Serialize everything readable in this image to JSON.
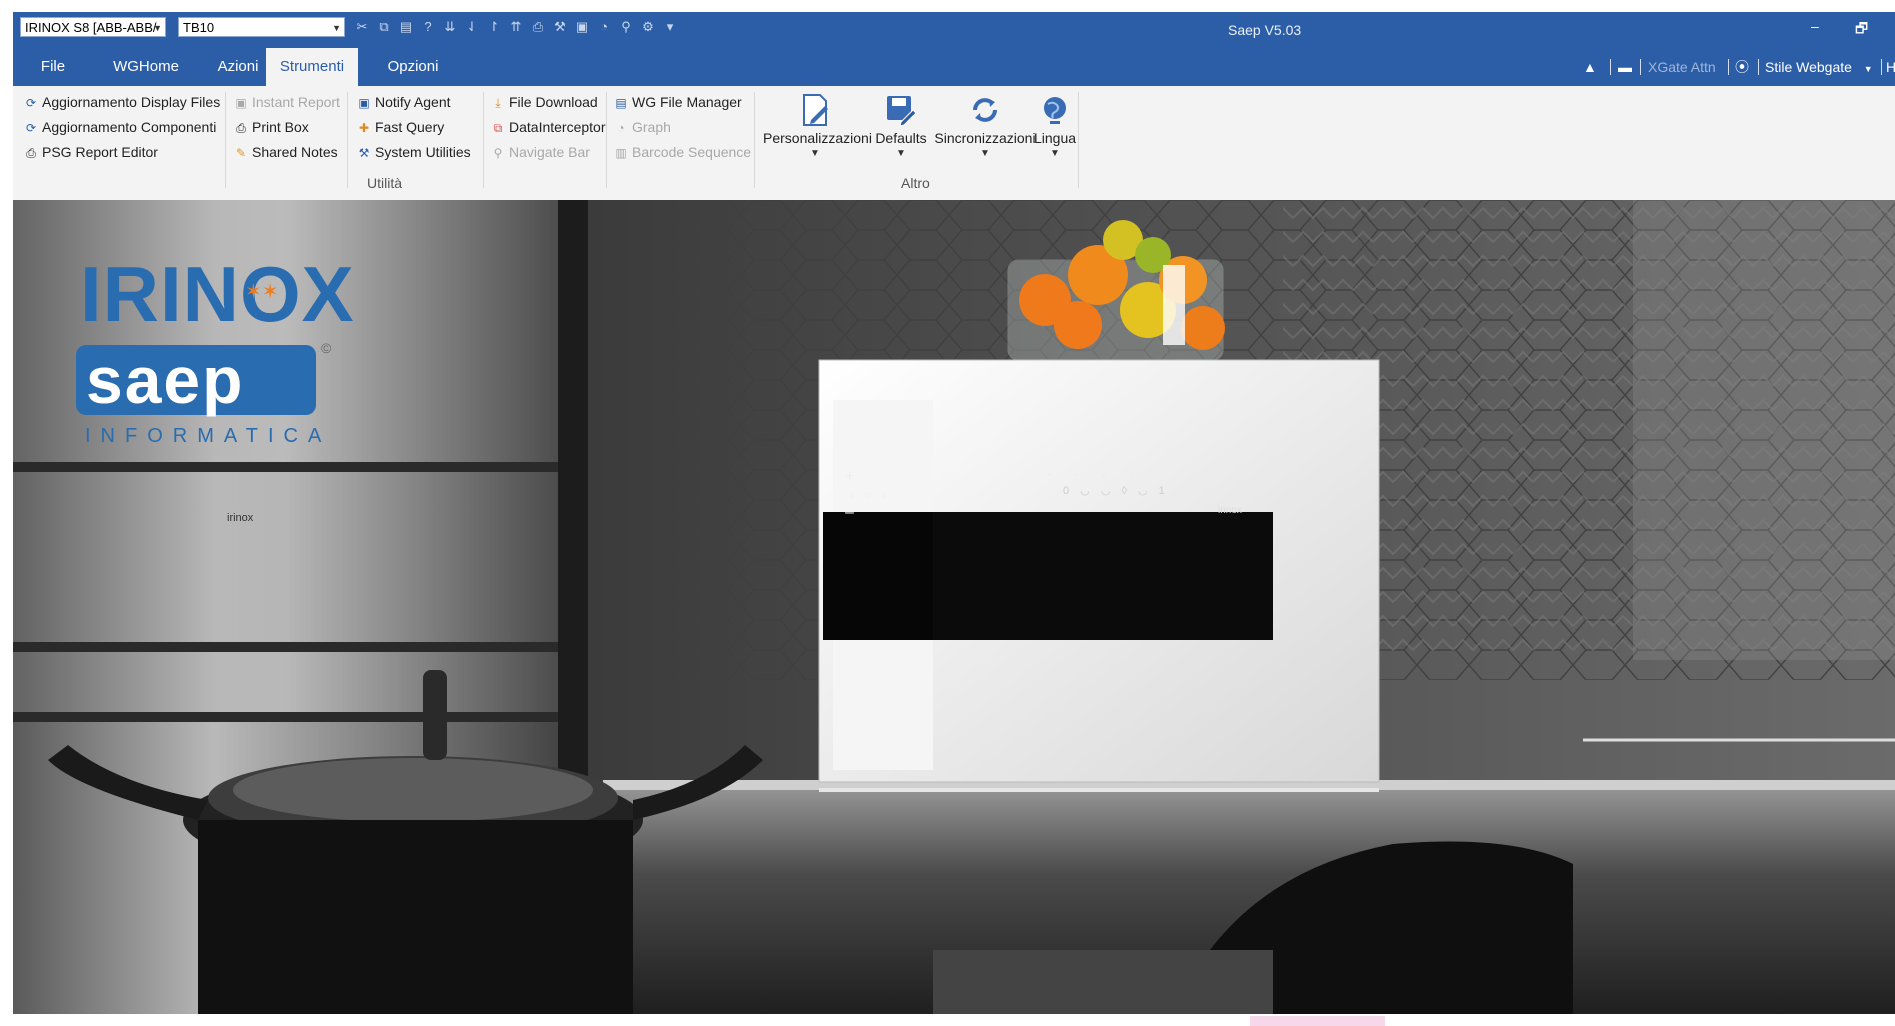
{
  "window": {
    "title": "Saep V5.03",
    "company_combo": "IRINOX S8 [ABB-ABB/",
    "code_combo": "TB10",
    "quick_access_icons": [
      "scissors-icon",
      "copy-icon",
      "paste-icon",
      "help-icon",
      "sort-asc-icon",
      "sort-desc-icon",
      "sort-up-icon",
      "sort-down-icon",
      "print-icon",
      "tools-icon",
      "report-icon",
      "chart-icon",
      "pin-icon",
      "settings-icon",
      "customize-icon"
    ],
    "controls": {
      "minimize": "–",
      "restore": "🗗"
    }
  },
  "tabs": [
    {
      "label": "File"
    },
    {
      "label": "WGHome"
    },
    {
      "label": "Azioni"
    },
    {
      "label": "Strumenti"
    },
    {
      "label": "Opzioni"
    }
  ],
  "right_controls": {
    "collapse_icon": "chevron-up-icon",
    "xgate": "XGate Attn",
    "style": "Stile Webgate",
    "help": "He"
  },
  "ribbon": {
    "col1": [
      "Aggiornamento Display Files",
      "Aggiornamento Componenti",
      "PSG Report Editor"
    ],
    "col2": [
      "Instant Report",
      "Print Box",
      "Shared Notes"
    ],
    "col3": [
      "Notify Agent",
      "Fast Query",
      "System Utilities"
    ],
    "col4": [
      "File Download",
      "DataInterceptor",
      "Navigate Bar"
    ],
    "col5": [
      "WG File Manager",
      "Graph",
      "Barcode Sequence"
    ],
    "group1_label": "Utilità",
    "group2_label": "Altro",
    "big_buttons": [
      "Personalizzazioni",
      "Defaults",
      "Sincronizzazioni",
      "Lingua"
    ]
  },
  "splash": {
    "brand1": "IRINOX",
    "brand2": "saep",
    "brand2_sub": "INFORMATICA",
    "device_mark": "irinox",
    "panel_digits": "0 ◡ ◡ ◊ ◡ 1"
  },
  "colors": {
    "accent": "#2c5ea8",
    "ribbon_bg": "#f3f3f3",
    "irinox_blue": "#2a6cb0",
    "star_orange": "#f07b1a"
  }
}
